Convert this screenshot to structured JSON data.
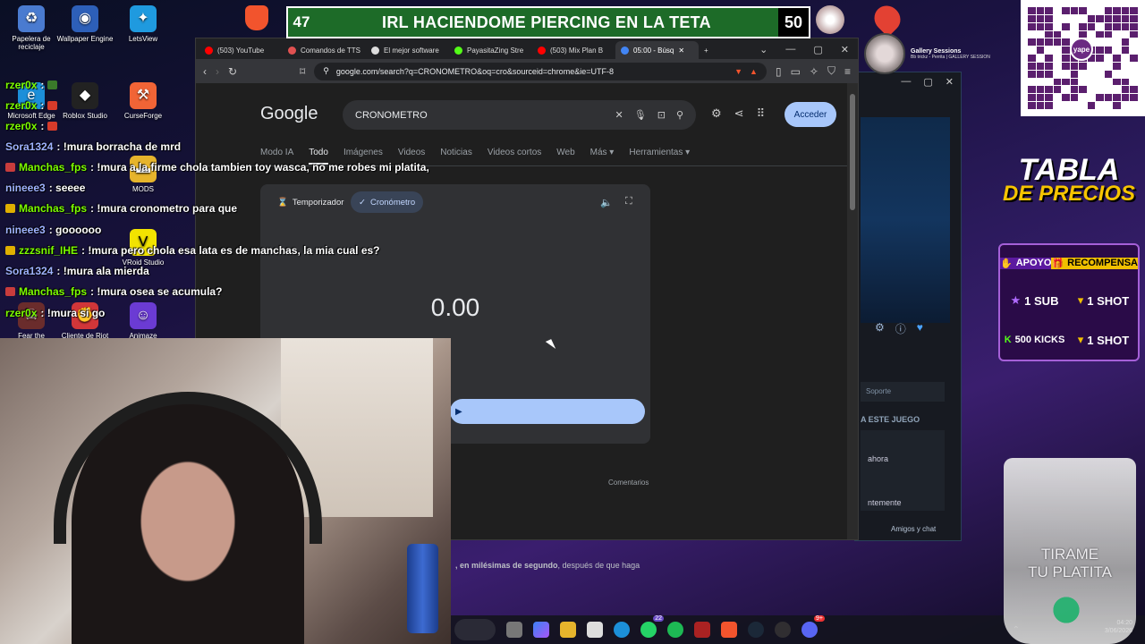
{
  "overlay": {
    "title_left_num": "47",
    "title_text": "IRL HACIENDOME PIERCING EN LA TETA",
    "title_right_num": "50"
  },
  "desktop_icons": [
    {
      "label": "Papelera de reciclaje",
      "icon": "recycle-bin-icon",
      "color": "#4a7bd0"
    },
    {
      "label": "Wallpaper Engine",
      "icon": "wallpaper-engine-icon",
      "color": "#2d5fb8"
    },
    {
      "label": "LetsView",
      "icon": "letsview-icon",
      "color": "#1f9adf"
    },
    {
      "label": "Microsoft Edge",
      "icon": "edge-icon",
      "color": "#1c8fd9"
    },
    {
      "label": "Roblox Studio",
      "icon": "roblox-icon",
      "color": "#222222"
    },
    {
      "label": "CurseForge",
      "icon": "curseforge-icon",
      "color": "#f16436"
    },
    {
      "label": "MODS",
      "icon": "folder-icon",
      "color": "#e6b42c"
    },
    {
      "label": "VRoid Studio",
      "icon": "vroid-icon",
      "color": "#f2e300"
    },
    {
      "label": "Fear the",
      "icon": "game-icon",
      "color": "#6a2c2c"
    },
    {
      "label": "Cliente de Riot",
      "icon": "riot-icon",
      "color": "#d13639"
    },
    {
      "label": "Animaze",
      "icon": "animaze-icon",
      "color": "#6b3bd4"
    }
  ],
  "browser": {
    "tabs": [
      {
        "label": "(503) YouTube",
        "color": "#ff0000"
      },
      {
        "label": "Comandos de TTS",
        "color": "#e05151"
      },
      {
        "label": "El mejor software",
        "color": "#dddddd"
      },
      {
        "label": "PayasitaZing Stre",
        "color": "#53fc18"
      },
      {
        "label": "(503) Mix Plan B",
        "color": "#ff0000"
      },
      {
        "label": "05:00 - Búsq",
        "color": "#4285f4"
      }
    ],
    "url": "google.com/search?q=CRONOMETRO&oq=cro&sourceid=chrome&ie=UTF-8"
  },
  "google": {
    "logo": "Google",
    "query": "CRONOMETRO",
    "signin": "Acceder",
    "nav_tabs": [
      "Modo IA",
      "Todo",
      "Imágenes",
      "Videos",
      "Noticias",
      "Videos cortos",
      "Web",
      "Más ▾",
      "Herramientas ▾"
    ],
    "active_tab": "Todo",
    "timer_tab": "Temporizador",
    "stopwatch_tab": "Cronómetro",
    "stopwatch_value": "0.00",
    "start_icon": "▶",
    "comments": "Comentarios",
    "snippet_bold": ", en milésimas de segundo",
    "snippet_rest": ", después de que haga"
  },
  "steam": {
    "support": "Soporte",
    "section": "A ESTE JUEGO",
    "line1": "ahora",
    "line2": "ntemente",
    "friends": "Amigos y chat"
  },
  "chat": [
    {
      "user": "rzer0x",
      "msg": ":",
      "color": "#7cfc00"
    },
    {
      "user": "rzer0x",
      "msg": ":",
      "color": "#7cfc00"
    },
    {
      "user": "rzer0x",
      "msg": ":",
      "color": "#7cfc00"
    },
    {
      "user": "Sora1324",
      "msg": ": !mura borracha de mrd",
      "color": "#9fb3ff"
    },
    {
      "user": "Manchas_fps",
      "msg": ": !mura a la firme chola tambien toy wasca, no me robes mi platita,",
      "color": "#7cfc00"
    },
    {
      "user": "nineee3",
      "msg": ": seeee",
      "color": "#9fb3ff"
    },
    {
      "user": "Manchas_fps",
      "msg": ": !mura cronometro para que",
      "color": "#7cfc00"
    },
    {
      "user": "nineee3",
      "msg": ": goooooo",
      "color": "#9fb3ff"
    },
    {
      "user": "zzzsnif_IHE",
      "msg": ": !mura pero chola esa lata es de manchas, la mia cual es?",
      "color": "#7cfc00"
    },
    {
      "user": "Sora1324",
      "msg": ": !mura ala mierda",
      "color": "#9fb3ff"
    },
    {
      "user": "Manchas_fps",
      "msg": ": !mura osea se acumula?",
      "color": "#7cfc00"
    },
    {
      "user": "rzer0x",
      "msg": ": !mura si go",
      "color": "#7cfc00"
    }
  ],
  "gallery": {
    "title": "Gallery Sessions",
    "subtitle": "Bb trickz - Perrita | GALLERY SESSION"
  },
  "qr_badge": "yape",
  "prices": {
    "title_a": "TABLA",
    "title_b": "DE PRECIOS",
    "head_left": "APOYO",
    "head_right": "RECOMPENSA",
    "rows": [
      {
        "left": "1 SUB",
        "right": "1 SHOT"
      },
      {
        "left": "500 KICKS",
        "right": "1 SHOT"
      }
    ]
  },
  "glass": {
    "line1": "TIRAME",
    "line2": "TU PLATITA"
  },
  "clock": {
    "time": "04:20",
    "date": "3/06/2026"
  },
  "taskbar_badges": {
    "whatsapp": "22",
    "discord": "9+"
  }
}
